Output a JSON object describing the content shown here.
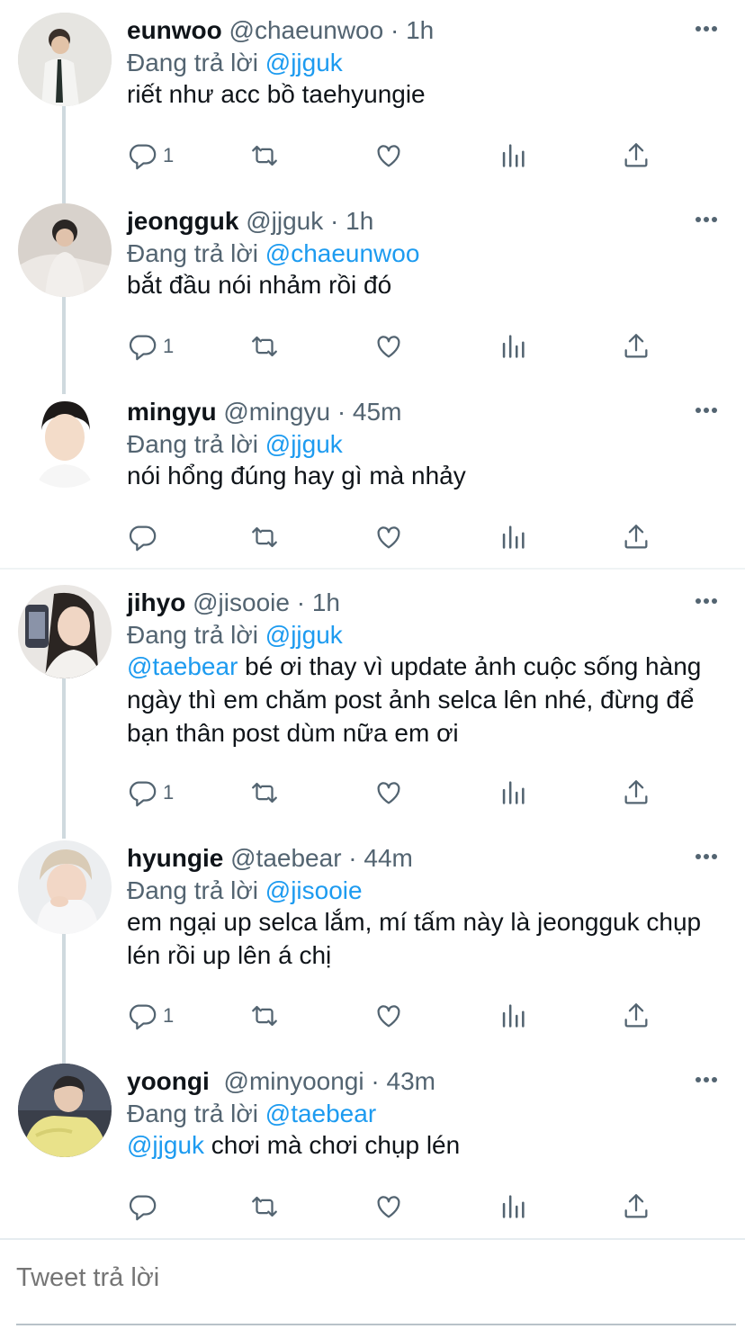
{
  "replying_label": "Đang trả lời",
  "colors": {
    "accent": "#1d9bf0",
    "secondary": "#536471",
    "thread_line": "#cfd9de"
  },
  "tweets": [
    {
      "name": "eunwoo",
      "handle": "@chaeunwoo",
      "separator": "·",
      "time": "1h",
      "replying_to": "@jjguk",
      "text": "riết như acc bồ taehyungie",
      "reply_count": "1",
      "mention": ""
    },
    {
      "name": "jeongguk",
      "handle": "@jjguk",
      "separator": "·",
      "time": "1h",
      "replying_to": "@chaeunwoo",
      "text": "bắt đầu nói nhảm rồi đó",
      "reply_count": "1",
      "mention": ""
    },
    {
      "name": "mingyu",
      "handle": "@mingyu",
      "separator": "·",
      "time": "45m",
      "replying_to": "@jjguk",
      "text": "nói hổng đúng hay gì mà nhảy",
      "reply_count": "",
      "mention": ""
    },
    {
      "name": "jihyo",
      "handle": "@jisooie",
      "separator": "·",
      "time": "1h",
      "replying_to": "@jjguk",
      "mention": "@taebear",
      "text": " bé ơi thay vì update ảnh cuộc sống hàng ngày thì em chăm post ảnh selca lên nhé, đừng để bạn thân post dùm nữa em ơi",
      "reply_count": "1"
    },
    {
      "name": "hyungie",
      "handle": "@taebear",
      "separator": "·",
      "time": "44m",
      "replying_to": "@jisooie",
      "text": "em ngại up selca lắm, mí tấm này là jeongguk chụp lén rồi up lên á chị",
      "reply_count": "1",
      "mention": ""
    },
    {
      "name": "yoongi",
      "handle": "@minyoongi",
      "separator": "·",
      "time": "43m",
      "replying_to": "@taebear",
      "mention": "@jjguk",
      "text": " chơi mà chơi chụp lén",
      "reply_count": "",
      "mention_present": true
    }
  ],
  "icons": [
    "reply-icon",
    "retweet-icon",
    "like-icon",
    "analytics-icon",
    "share-icon",
    "more-icon"
  ],
  "reply_box": {
    "placeholder": "Tweet trả lời"
  }
}
